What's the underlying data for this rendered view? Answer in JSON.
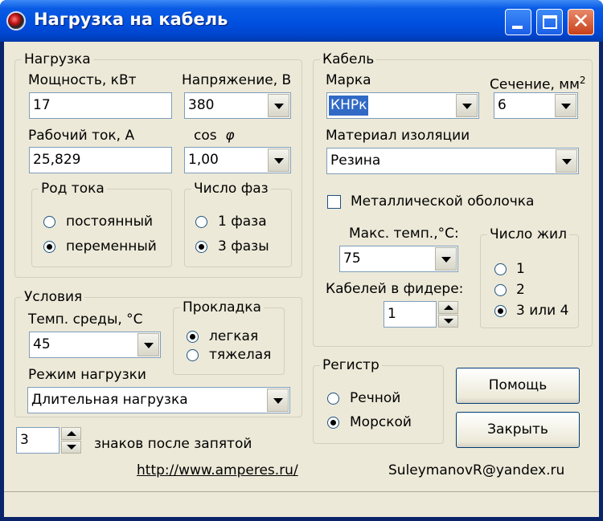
{
  "window": {
    "title": "Нагрузка на кабель"
  },
  "load": {
    "group": "Нагрузка",
    "power_label": "Мощность, кВт",
    "power_value": "17",
    "voltage_label": "Напряжение, В",
    "voltage_value": "380",
    "current_label": "Рабочий ток, А",
    "current_value": "25,829",
    "cos_label": "cos",
    "cos_symbol": "φ",
    "cos_value": "1,00",
    "current_type": {
      "group": "Род тока",
      "options": [
        "постоянный",
        "переменный"
      ],
      "selected": "переменный"
    },
    "phases": {
      "group": "Число фаз",
      "options": [
        "1 фаза",
        "3 фазы"
      ],
      "selected": "3 фазы"
    }
  },
  "conditions": {
    "group": "Условия",
    "temp_label": "Темп. среды, °C",
    "temp_value": "45",
    "laying": {
      "group": "Прокладка",
      "options": [
        "легкая",
        "тяжелая"
      ],
      "selected": "легкая"
    },
    "mode_label": "Режим нагрузки",
    "mode_value": "Длительная нагрузка"
  },
  "cable": {
    "group": "Кабель",
    "brand_label": "Марка",
    "brand_value": "КНРк",
    "section_label": "Сечение, мм",
    "section_sup": "2",
    "section_value": "6",
    "insulation_label": "Материал изоляции",
    "insulation_value": "Резина",
    "metal_sheath_label": "Металлической оболочка",
    "metal_sheath_checked": false,
    "max_temp_label": "Макс. темп.,°C:",
    "max_temp_value": "75",
    "feeder_label": "Кабелей в фидере:",
    "feeder_value": "1",
    "cores": {
      "group": "Число жил",
      "options": [
        "1",
        "2",
        "3 или 4"
      ],
      "selected": "3 или 4"
    }
  },
  "register": {
    "group": "Регистр",
    "options": [
      "Речной",
      "Морской"
    ],
    "selected": "Морской"
  },
  "buttons": {
    "help": "Помощь",
    "close": "Закрыть"
  },
  "decimals": {
    "value": "3",
    "label": "знаков после запятой"
  },
  "footer": {
    "url": "http://www.amperes.ru/",
    "email": "SuleymanovR@yandex.ru"
  }
}
